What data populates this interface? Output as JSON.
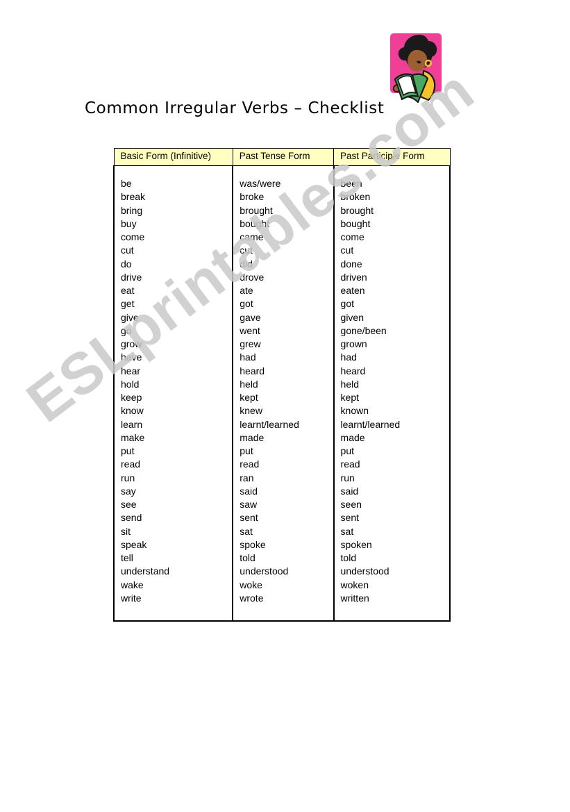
{
  "page": {
    "title": "Common Irregular Verbs – Checklist",
    "background_color": "#ffffff"
  },
  "watermark": {
    "text": "ESLprintables.com",
    "color": "#c9c9c9"
  },
  "clipart": {
    "name": "girl-reading-book-illustration",
    "background_color": "#ef3f96",
    "book_color": "#4aa85f",
    "shirt_color": "#f6c428",
    "skin_color": "#9c5f34",
    "hair_color": "#1a1a1a"
  },
  "table": {
    "header_background": "#ffffbf",
    "border_color": "#000000",
    "headers": [
      "Basic Form (Infinitive)",
      "Past Tense Form",
      "Past Participle Form"
    ],
    "columns": {
      "base": [
        "be",
        "break",
        "bring",
        "buy",
        "come",
        "cut",
        "do",
        "drive",
        "eat",
        "get",
        "give",
        "go",
        "grow",
        "have",
        "hear",
        "hold",
        "keep",
        "know",
        "learn",
        "make",
        "put",
        "read",
        "run",
        "say",
        "see",
        "send",
        "sit",
        "speak",
        "tell",
        "understand",
        "wake",
        "write"
      ],
      "past": [
        "was/were",
        "broke",
        "brought",
        "bought",
        "came",
        "cut",
        "did",
        "drove",
        "ate",
        "got",
        "gave",
        "went",
        "grew",
        "had",
        "heard",
        "held",
        "kept",
        "knew",
        "learnt/learned",
        "made",
        "put",
        "read",
        "ran",
        "said",
        "saw",
        "sent",
        "sat",
        "spoke",
        "told",
        "understood",
        "woke",
        "wrote"
      ],
      "participle": [
        "been",
        "broken",
        "brought",
        "bought",
        "come",
        "cut",
        "done",
        "driven",
        "eaten",
        "got",
        "given",
        "gone/been",
        "grown",
        "had",
        "heard",
        "held",
        "kept",
        "known",
        "learnt/learned",
        "made",
        "put",
        "read",
        "run",
        "said",
        "seen",
        "sent",
        "sat",
        "spoken",
        "told",
        "understood",
        "woken",
        "written"
      ]
    }
  }
}
